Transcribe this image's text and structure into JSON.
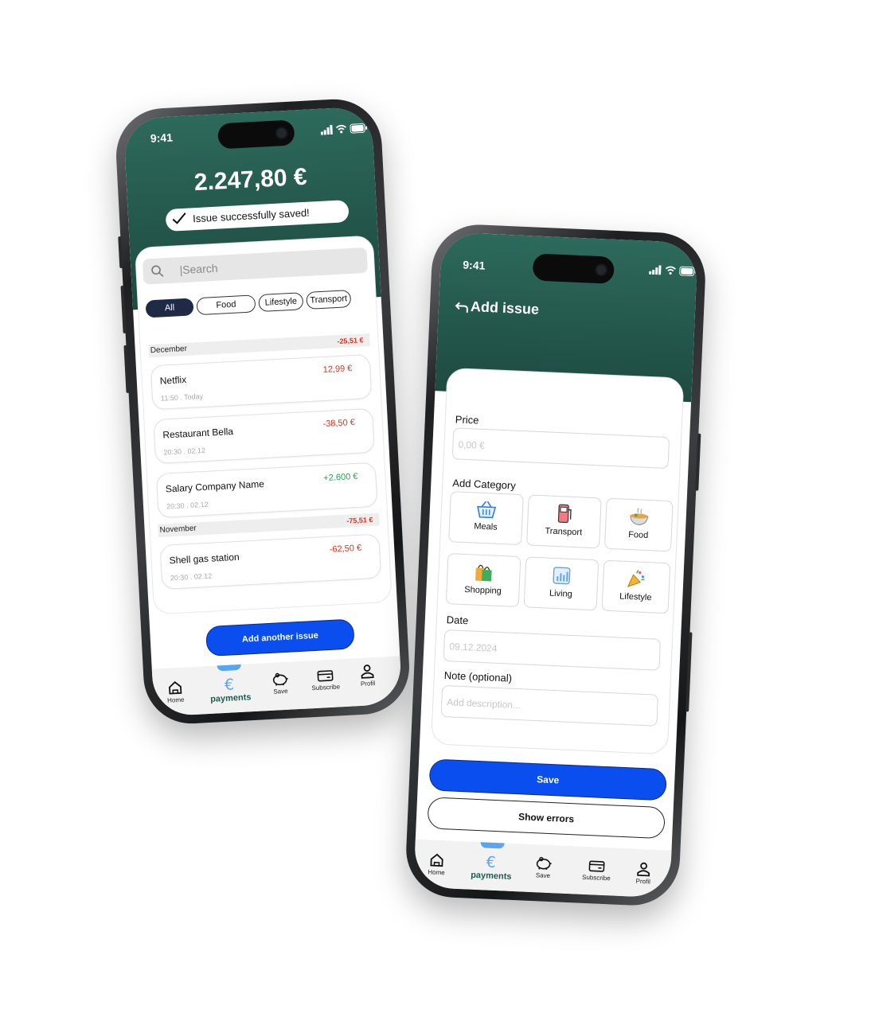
{
  "status": {
    "time": "9:41"
  },
  "list_screen": {
    "balance": "2.247,80 €",
    "toast": "Issue successfully saved!",
    "search_placeholder": "|Search",
    "filters": [
      "All",
      "Food",
      "Lifestyle",
      "Transport"
    ],
    "sections": [
      {
        "month": "December",
        "total": "-25,51 €",
        "items": [
          {
            "name": "Netflix",
            "meta": "11:50 . Today",
            "amount": "12,99 €",
            "sign": "neg"
          },
          {
            "name": "Restaurant Bella",
            "meta": "20:30 . 02.12",
            "amount": "-38,50 €",
            "sign": "neg"
          },
          {
            "name": "Salary Company Name",
            "meta": "20:30 . 02.12",
            "amount": "+2.600 €",
            "sign": "pos"
          }
        ]
      },
      {
        "month": "November",
        "total": "-75,51 €",
        "items": [
          {
            "name": "Shell gas station",
            "meta": "20:30 . 02.12",
            "amount": "-62,50 €",
            "sign": "neg"
          }
        ]
      }
    ],
    "add_button": "Add another issue"
  },
  "add_screen": {
    "title": "Add issue",
    "price_label": "Price",
    "price_placeholder": "0,00 €",
    "category_label": "Add Category",
    "categories": [
      "Meals",
      "Transport",
      "Food",
      "Shopping",
      "Living",
      "Lifestyle"
    ],
    "date_label": "Date",
    "date_placeholder": "09.12.2024",
    "note_label": "Note (optional)",
    "note_placeholder": "Add description...",
    "save_button": "Save",
    "errors_button": "Show errors"
  },
  "tabbar": {
    "home": "Home",
    "payments": "payments",
    "save": "Save",
    "subscribe": "Subscribe",
    "profile": "Profil"
  },
  "colors": {
    "header_green": "#24584c",
    "primary_blue": "#0a4ef0",
    "negative": "#e0311d",
    "positive": "#1faa52",
    "chip_active": "#1f2b46"
  }
}
